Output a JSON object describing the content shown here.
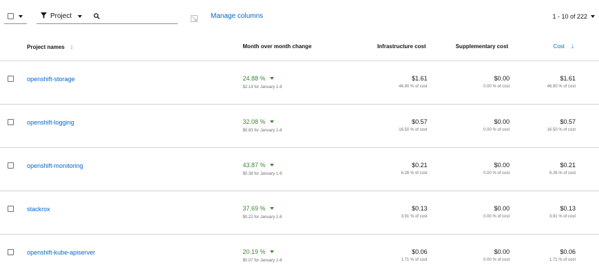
{
  "toolbar": {
    "filter_label": "Project",
    "search_placeholder": "",
    "manage_columns": "Manage columns",
    "pagination": "1 - 10 of 222"
  },
  "columns": {
    "name": "Project names",
    "mom": "Month over month change",
    "infra": "Infrastructure cost",
    "supp": "Supplementary cost",
    "cost": "Cost"
  },
  "rows": [
    {
      "name": "openshift-storage",
      "mom_pct": "24.88 %",
      "mom_sub": "$2.14 for January 1-8",
      "infra": "$1.61",
      "infra_pct": "46.90 % of cost",
      "supp": "$0.00",
      "supp_pct": "0.00 % of cost",
      "cost": "$1.61",
      "cost_pct": "46.90 % of cost"
    },
    {
      "name": "openshift-logging",
      "mom_pct": "32.08 %",
      "mom_sub": "$0.83 for January 1-8",
      "infra": "$0.57",
      "infra_pct": "16.50 % of cost",
      "supp": "$0.00",
      "supp_pct": "0.00 % of cost",
      "cost": "$0.57",
      "cost_pct": "16.50 % of cost"
    },
    {
      "name": "openshift-monitoring",
      "mom_pct": "43.87 %",
      "mom_sub": "$0.38 for January 1-8",
      "infra": "$0.21",
      "infra_pct": "6.26 % of cost",
      "supp": "$0.00",
      "supp_pct": "0.00 % of cost",
      "cost": "$0.21",
      "cost_pct": "6.26 % of cost"
    },
    {
      "name": "stackrox",
      "mom_pct": "37.69 %",
      "mom_sub": "$0.22 for January 1-8",
      "infra": "$0.13",
      "infra_pct": "3.91 % of cost",
      "supp": "$0.00",
      "supp_pct": "0.00 % of cost",
      "cost": "$0.13",
      "cost_pct": "3.91 % of cost"
    },
    {
      "name": "openshift-kube-apiserver",
      "mom_pct": "20.19 %",
      "mom_sub": "$0.07 for January 1-8",
      "infra": "$0.06",
      "infra_pct": "1.71 % of cost",
      "supp": "$0.00",
      "supp_pct": "0.00 % of cost",
      "cost": "$0.06",
      "cost_pct": "1.71 % of cost"
    }
  ],
  "icons": {
    "filter": "filter-icon",
    "search": "search-icon",
    "export": "export-icon",
    "sort": "sort-icon",
    "sort_active": "sort-descending-icon"
  },
  "colors": {
    "link": "#0066cc",
    "positive": "#3e8635"
  }
}
